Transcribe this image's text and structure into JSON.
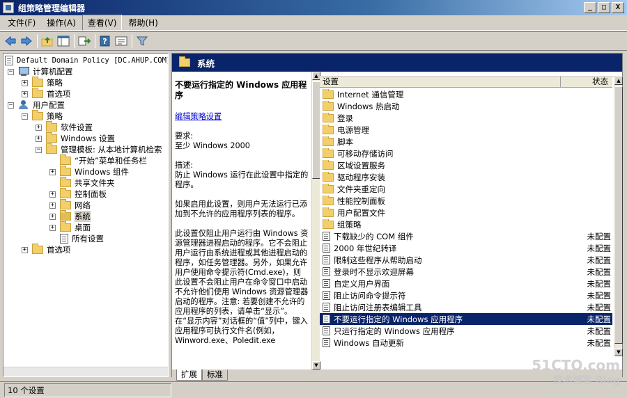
{
  "window": {
    "title": "组策略管理编辑器",
    "min": "_",
    "max": "□",
    "close": "X"
  },
  "menus": [
    "文件(F)",
    "操作(A)",
    "查看(V)",
    "帮助(H)"
  ],
  "tree": {
    "root": "Default Domain Policy [DC.AHUP.COM]",
    "items": [
      {
        "label": "计算机配置",
        "pm": "−"
      },
      {
        "label": "策略",
        "pm": "+"
      },
      {
        "label": "首选项",
        "pm": "+"
      },
      {
        "label": "用户配置",
        "pm": "−"
      },
      {
        "label": "策略",
        "pm": "−"
      },
      {
        "label": "软件设置",
        "pm": "+"
      },
      {
        "label": "Windows 设置",
        "pm": "+"
      },
      {
        "label": "管理模板: 从本地计算机检索",
        "pm": "−"
      },
      {
        "label": "“开始”菜单和任务栏",
        "pm": ""
      },
      {
        "label": "Windows 组件",
        "pm": "+"
      },
      {
        "label": "共享文件夹",
        "pm": ""
      },
      {
        "label": "控制面板",
        "pm": "+"
      },
      {
        "label": "网络",
        "pm": "+"
      },
      {
        "label": "系统",
        "pm": "+"
      },
      {
        "label": "桌面",
        "pm": "+"
      },
      {
        "label": "所有设置",
        "pm": ""
      },
      {
        "label": "首选项",
        "pm": "+"
      }
    ]
  },
  "header": {
    "title": "系统"
  },
  "description": {
    "title": "不要运行指定的 Windows 应用程序",
    "edit_link": "编辑策略设置",
    "req_label": "要求:",
    "req_value": "至少 Windows 2000",
    "desc_label": "描述:",
    "desc_value": "防止 Windows 运行在此设置中指定的程序。",
    "para1": "如果启用此设置，则用户无法运行已添加到不允许的应用程序列表的程序。",
    "para2": "此设置仅阻止用户运行由 Windows 资源管理器进程启动的程序。它不会阻止用户运行由系统进程或其他进程启动的程序，如任务管理器。另外，如果允许用户使用命令提示符(Cmd.exe)，则此设置不会阻止用户在命令窗口中启动不允许他们使用 Windows 资源管理器启动的程序。注意: 若要创建不允许的应用程序的列表，请单击“显示”。在“显示内容”对话框的“值”列中，键入应用程序可执行文件名(例如，Winword.exe、Poledit.exe"
  },
  "list": {
    "col_setting": "设置",
    "col_state": "状态",
    "folders": [
      "Internet 通信管理",
      "Windows 热启动",
      "登录",
      "电源管理",
      "脚本",
      "可移动存储访问",
      "区域设置服务",
      "驱动程序安装",
      "文件夹重定向",
      "性能控制面板",
      "用户配置文件",
      "组策略"
    ],
    "policies": [
      {
        "name": "下载缺少的 COM 组件",
        "state": "未配置"
      },
      {
        "name": "2000 年世纪转译",
        "state": "未配置"
      },
      {
        "name": "限制这些程序从帮助启动",
        "state": "未配置"
      },
      {
        "name": "登录时不显示欢迎屏幕",
        "state": "未配置"
      },
      {
        "name": "自定义用户界面",
        "state": "未配置"
      },
      {
        "name": "阻止访问命令提示符",
        "state": "未配置"
      },
      {
        "name": "阻止访问注册表编辑工具",
        "state": "未配置"
      },
      {
        "name": "不要运行指定的 Windows 应用程序",
        "state": "未配置"
      },
      {
        "name": "只运行指定的 Windows 应用程序",
        "state": "未配置"
      },
      {
        "name": "Windows 自动更新",
        "state": "未配置"
      }
    ]
  },
  "tabs": [
    "扩展",
    "标准"
  ],
  "status": "10 个设置",
  "watermark": {
    "main": "51CTO.com",
    "sub": "技术博客 Blog"
  }
}
